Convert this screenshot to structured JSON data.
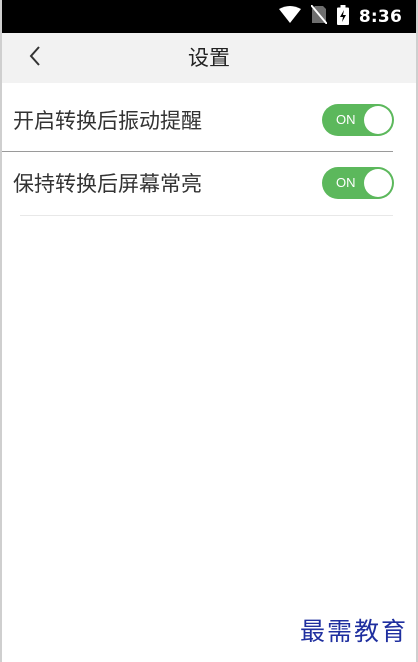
{
  "status_bar": {
    "time": "8:36",
    "icons": [
      "wifi-icon",
      "no-sim-icon",
      "battery-charging-icon"
    ]
  },
  "header": {
    "title": "设置",
    "back_icon": "chevron-left-icon"
  },
  "settings": [
    {
      "label": "开启转换后振动提醒",
      "toggle_text": "ON",
      "enabled": true
    },
    {
      "label": "保持转换后屏幕常亮",
      "toggle_text": "ON",
      "enabled": true
    }
  ],
  "watermark": "最需教育",
  "colors": {
    "status_bar": "#000000",
    "title_bar": "#f2f2f2",
    "toggle_on": "#5cb85c",
    "watermark": "#1f2f9f"
  }
}
